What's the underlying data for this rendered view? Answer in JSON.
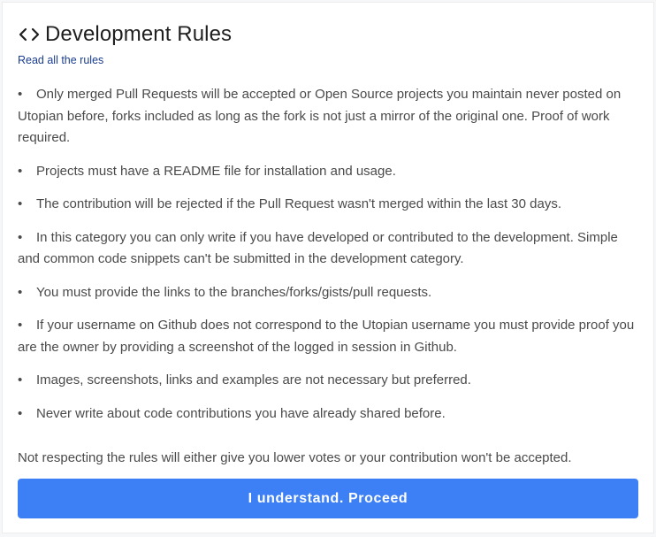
{
  "dialog": {
    "title": "Development Rules",
    "title_icon": "code-brackets-icon",
    "read_rules_link": "Read all the rules",
    "rules": [
      "Only merged Pull Requests will be accepted or Open Source projects you maintain never posted on Utopian before, forks included as long as the fork is not just a mirror of the original one. Proof of work required.",
      "Projects must have a README file for installation and usage.",
      "The contribution will be rejected if the Pull Request wasn't merged within the last 30 days.",
      "In this category you can only write if you have developed or contributed to the development. Simple and common code snippets can't be submitted in the development category.",
      "You must provide the links to the branches/forks/gists/pull requests.",
      "If your username on Github does not correspond to the Utopian username you must provide proof you are the owner by providing a screenshot of the logged in session in Github.",
      "Images, screenshots, links and examples are not necessary but preferred.",
      "Never write about code contributions you have already shared before."
    ],
    "footer_note": "Not respecting the rules will either give you lower votes or your contribution won't be accepted.",
    "proceed_label": "I understand. Proceed"
  },
  "colors": {
    "accent": "#3d7ff5",
    "link": "#1a3d8f",
    "text": "#4a4a4a",
    "title": "#1f1f1f"
  }
}
